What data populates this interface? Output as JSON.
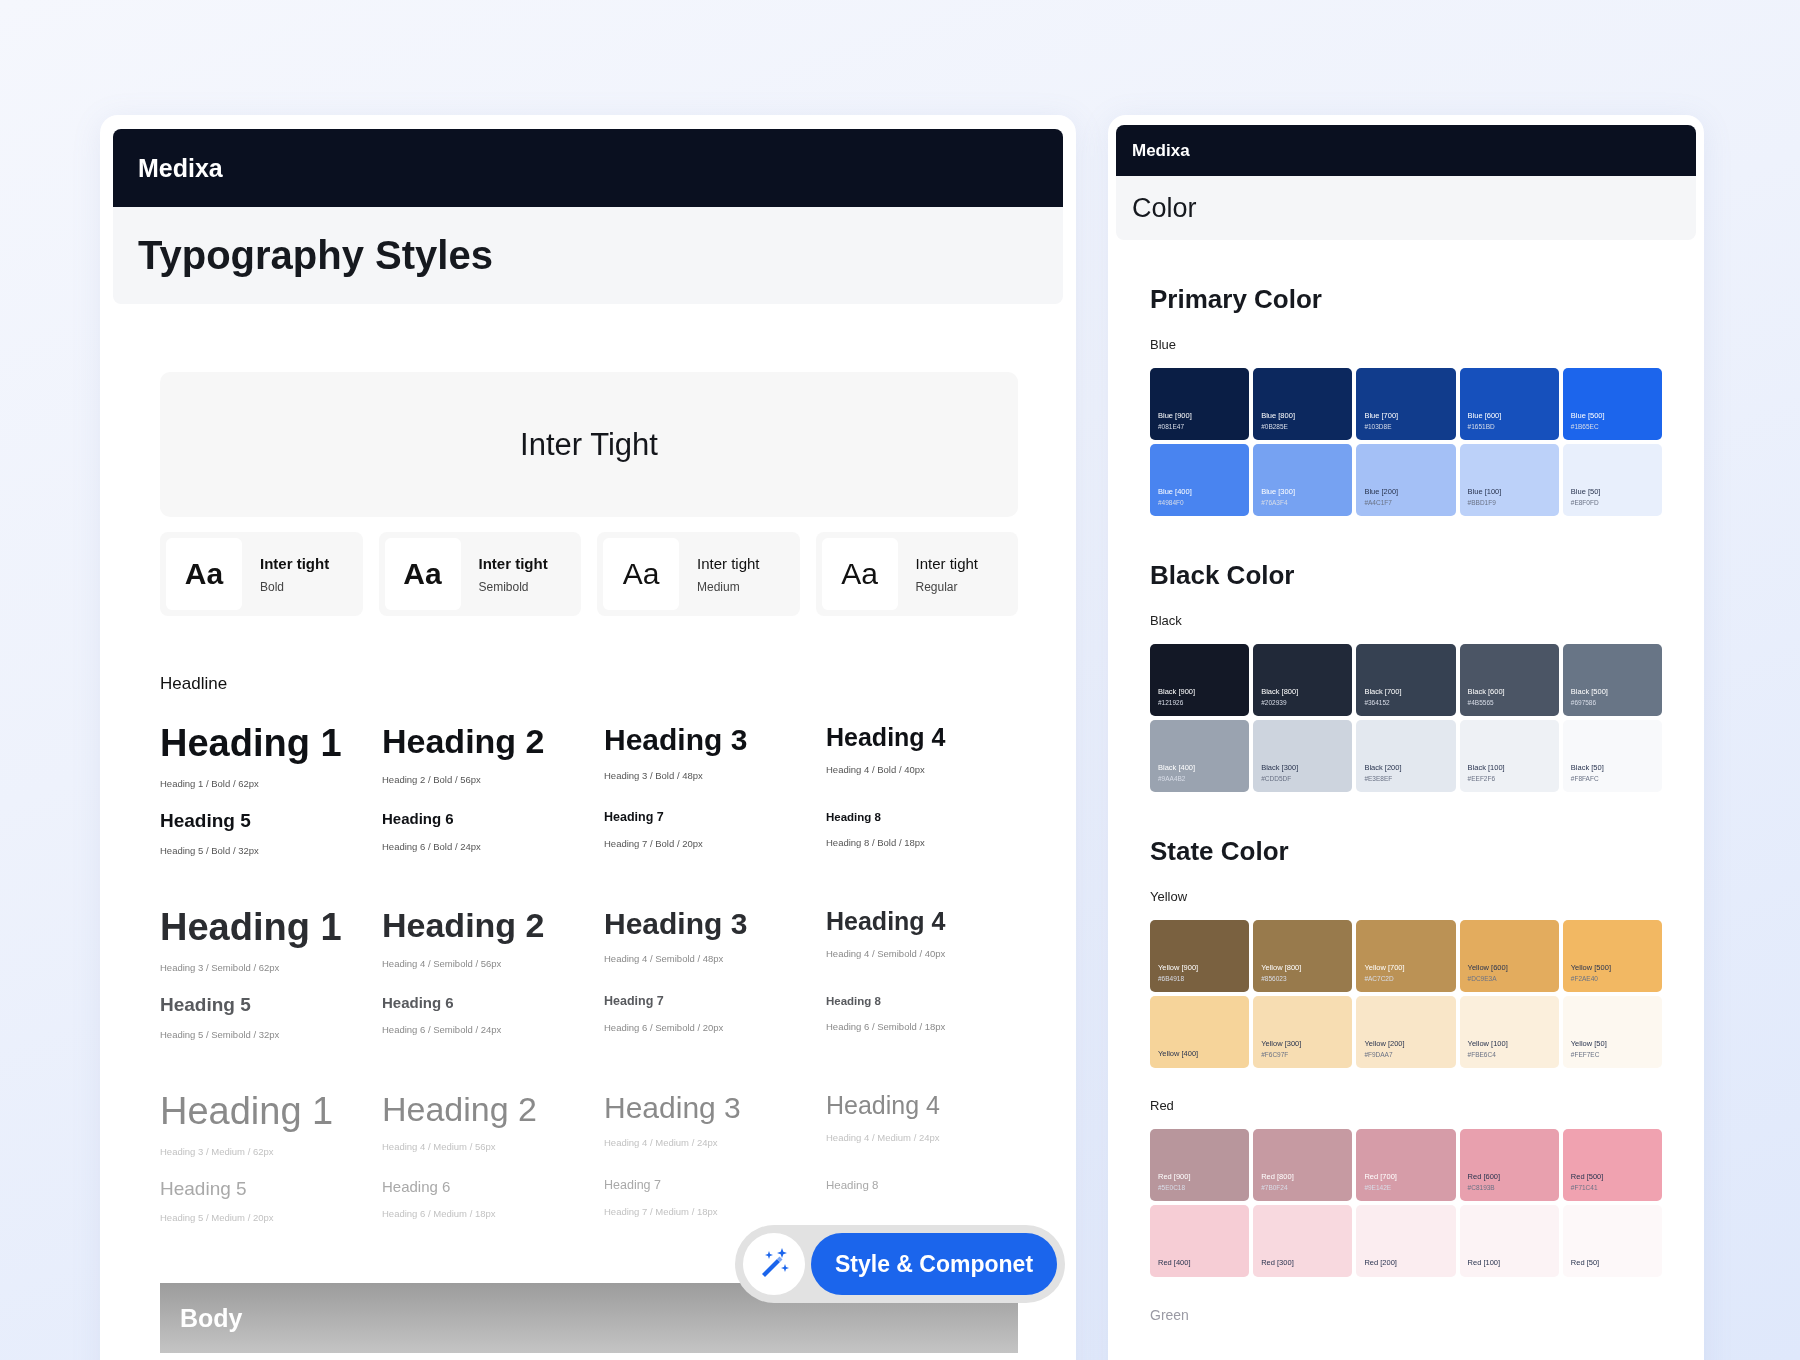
{
  "typography_board": {
    "brand": "Medixa",
    "title": "Typography Styles",
    "font_showcase": {
      "name": "Inter Tight"
    },
    "weights": [
      {
        "sample": "Aa",
        "name": "Inter tight",
        "weight": "Bold",
        "kind": "bold"
      },
      {
        "sample": "Aa",
        "name": "Inter tight",
        "weight": "Semibold",
        "kind": "semibold"
      },
      {
        "sample": "Aa",
        "name": "Inter tight",
        "weight": "Medium",
        "kind": "medium"
      },
      {
        "sample": "Aa",
        "name": "Inter tight",
        "weight": "Regular",
        "kind": "regular"
      }
    ],
    "section": "Headline",
    "groups": [
      {
        "kind": "bold",
        "items": [
          {
            "text": "Heading 1",
            "caption": "Heading 1 / Bold / 62px"
          },
          {
            "text": "Heading 2",
            "caption": "Heading 2  / Bold / 56px"
          },
          {
            "text": "Heading 3",
            "caption": "Heading 3 / Bold / 48px"
          },
          {
            "text": "Heading 4",
            "caption": "Heading 4 / Bold / 40px"
          },
          {
            "text": "Heading 5",
            "caption": "Heading 5 / Bold / 32px"
          },
          {
            "text": "Heading 6",
            "caption": "Heading 6 / Bold / 24px"
          },
          {
            "text": "Heading 7",
            "caption": "Heading 7 / Bold / 20px"
          },
          {
            "text": "Heading 8",
            "caption": "Heading 8 / Bold / 18px"
          }
        ]
      },
      {
        "kind": "semibold",
        "items": [
          {
            "text": "Heading 1",
            "caption": "Heading 3 / Semibold / 62px"
          },
          {
            "text": "Heading 2",
            "caption": "Heading 4 / Semibold / 56px"
          },
          {
            "text": "Heading 3",
            "caption": "Heading 4 / Semibold / 48px"
          },
          {
            "text": "Heading 4",
            "caption": "Heading 4 / Semibold / 40px"
          },
          {
            "text": "Heading 5",
            "caption": "Heading 5 / Semibold / 32px"
          },
          {
            "text": "Heading 6",
            "caption": "Heading 6 / Semibold / 24px"
          },
          {
            "text": "Heading 7",
            "caption": "Heading 6 / Semibold / 20px"
          },
          {
            "text": "Heading 8",
            "caption": "Heading 6 / Semibold / 18px"
          }
        ]
      },
      {
        "kind": "medium",
        "items": [
          {
            "text": "Heading 1",
            "caption": "Heading 3 / Medium / 62px"
          },
          {
            "text": "Heading 2",
            "caption": "Heading 4 / Medium / 56px"
          },
          {
            "text": "Heading 3",
            "caption": "Heading 4 / Medium / 24px"
          },
          {
            "text": "Heading 4",
            "caption": "Heading 4 / Medium / 24px"
          },
          {
            "text": "Heading 5",
            "caption": "Heading 5 / Medium / 20px"
          },
          {
            "text": "Heading 6",
            "caption": "Heading 6 / Medium / 18px"
          },
          {
            "text": "Heading 7",
            "caption": "Heading 7 / Medium / 18px"
          },
          {
            "text": "Heading 8"
          }
        ]
      }
    ],
    "body_label": "Body"
  },
  "floating_button": {
    "label": "Style & Componet"
  },
  "color_board": {
    "brand": "Medixa",
    "title": "Color",
    "sections": [
      {
        "title": "Primary Color",
        "palettes": [
          {
            "name": "Blue",
            "swatches": [
              {
                "name": "Blue [900]",
                "hex": "#081E47",
                "color": "#0a1e45"
              },
              {
                "name": "Blue [800]",
                "hex": "#0B285E",
                "color": "#0c285e"
              },
              {
                "name": "Blue [700]",
                "hex": "#103D8E",
                "color": "#113c8c"
              },
              {
                "name": "Blue [600]",
                "hex": "#1651BD",
                "color": "#1650bc"
              },
              {
                "name": "Blue [500]",
                "hex": "#1B65EC",
                "color": "#1c65ec"
              },
              {
                "name": "Blue [400]",
                "hex": "#4984F0",
                "color": "#4984f0"
              },
              {
                "name": "Blue [300]",
                "hex": "#76A3F4",
                "color": "#76a2f2"
              },
              {
                "name": "Blue [200]",
                "hex": "#A4C1F7",
                "color": "#a4c0f6"
              },
              {
                "name": "Blue [100]",
                "hex": "#BBD1F9",
                "color": "#bcd1f9"
              },
              {
                "name": "Blue [50]",
                "hex": "#E8F0FD",
                "color": "#e8effc"
              }
            ]
          }
        ]
      },
      {
        "title": "Black Color",
        "palettes": [
          {
            "name": "Black",
            "swatches": [
              {
                "name": "Black [900]",
                "hex": "#121926",
                "color": "#131826"
              },
              {
                "name": "Black [800]",
                "hex": "#202939",
                "color": "#212939"
              },
              {
                "name": "Black [700]",
                "hex": "#364152",
                "color": "#364152"
              },
              {
                "name": "Black [600]",
                "hex": "#4B5565",
                "color": "#4b5565"
              },
              {
                "name": "Black [500]",
                "hex": "#697586",
                "color": "#687586"
              },
              {
                "name": "Black [400]",
                "hex": "#9AA4B2",
                "color": "#9aa3b0"
              },
              {
                "name": "Black [300]",
                "hex": "#CDD5DF",
                "color": "#cdd4de"
              },
              {
                "name": "Black [200]",
                "hex": "#E3E8EF",
                "color": "#e3e8ef"
              },
              {
                "name": "Black [100]",
                "hex": "#EEF2F6",
                "color": "#eef1f5"
              },
              {
                "name": "Black [50]",
                "hex": "#F8FAFC",
                "color": "#f8f9fb"
              }
            ]
          }
        ]
      },
      {
        "title": "State Color",
        "palettes": [
          {
            "name": "Yellow",
            "swatches": [
              {
                "name": "Yellow [900]",
                "hex": "#6B4918",
                "color": "#7a6140"
              },
              {
                "name": "Yellow [800]",
                "hex": "#856023",
                "color": "#987a4c"
              },
              {
                "name": "Yellow [700]",
                "hex": "#AC7C2D",
                "color": "#bb9255"
              },
              {
                "name": "Yellow [600]",
                "hex": "#DC9E3A",
                "color": "#e3ac5e"
              },
              {
                "name": "Yellow [500]",
                "hex": "#F2AE40",
                "color": "#f2b863"
              },
              {
                "name": "Yellow [400]",
                "color": "#f6d49a"
              },
              {
                "name": "Yellow [300]",
                "hex": "#F6C97F",
                "color": "#f7ddb2"
              },
              {
                "name": "Yellow [200]",
                "hex": "#F9DAA7",
                "color": "#f9e6c8"
              },
              {
                "name": "Yellow [100]",
                "hex": "#FBE6C4",
                "color": "#fbefdc"
              },
              {
                "name": "Yellow [50]",
                "hex": "#FEF7EC",
                "color": "#fdf8f0"
              }
            ]
          },
          {
            "name": "Red",
            "swatches": [
              {
                "name": "Red [900]",
                "hex": "#5E0C18",
                "color": "#b8969c"
              },
              {
                "name": "Red [800]",
                "hex": "#7B0F24",
                "color": "#c69aa2"
              },
              {
                "name": "Red [700]",
                "hex": "#9E142E",
                "color": "#d69ca8"
              },
              {
                "name": "Red [600]",
                "hex": "#C8193B",
                "color": "#e8a0ae"
              },
              {
                "name": "Red [500]",
                "hex": "#F71C41",
                "color": "#f0a2b0"
              },
              {
                "name": "Red [400]",
                "color": "#f6cdd5"
              },
              {
                "name": "Red [300]",
                "color": "#f8d9df"
              },
              {
                "name": "Red [200]",
                "color": "#fbedf0"
              },
              {
                "name": "Red [100]",
                "color": "#fcf3f5"
              },
              {
                "name": "Red [50]",
                "color": "#fdf8f9"
              }
            ]
          },
          {
            "name": "Green"
          }
        ]
      }
    ]
  }
}
